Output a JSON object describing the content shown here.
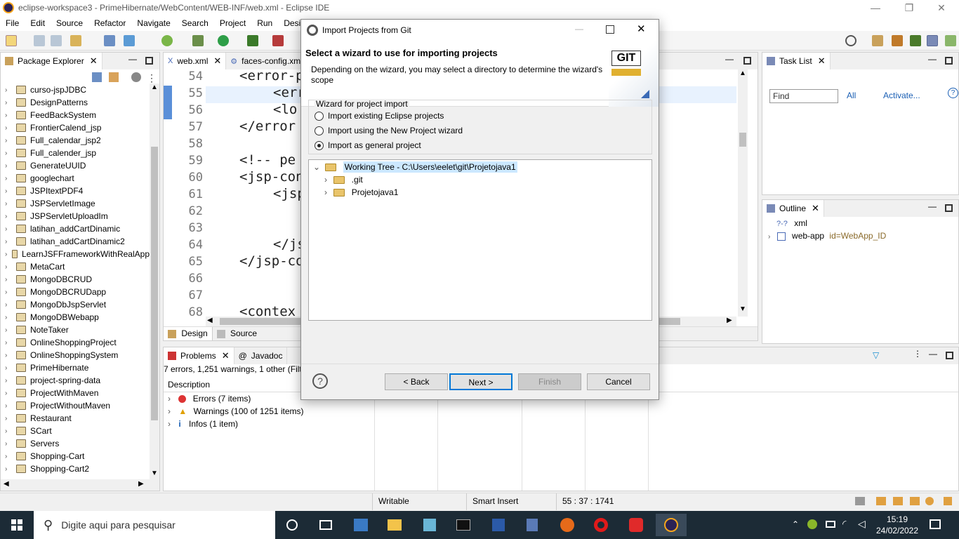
{
  "window": {
    "title": "eclipse-workspace3 - PrimeHibernate/WebContent/WEB-INF/web.xml - Eclipse IDE",
    "controls": [
      "—",
      "❐",
      "✕"
    ]
  },
  "menu": [
    "File",
    "Edit",
    "Source",
    "Refactor",
    "Navigate",
    "Search",
    "Project",
    "Run",
    "Design"
  ],
  "package_explorer": {
    "tab_label": "Package Explorer",
    "projects": [
      "curso-jspJDBC",
      "DesignPatterns",
      "FeedBackSystem",
      "FrontierCalend_jsp",
      "Full_calendar_jsp2",
      "Full_calender_jsp",
      "GenerateUUID",
      "googlechart",
      "JSPItextPDF4",
      "JSPServletImage",
      "JSPServletUploadIm",
      "latihan_addCartDinamic",
      "latihan_addCartDinamic2",
      "LearnJSFFrameworkWithRealApp",
      "MetaCart",
      "MongoDBCRUD",
      "MongoDBCRUDapp",
      "MongoDbJspServlet",
      "MongoDBWebapp",
      "NoteTaker",
      "OnlineShoppingProject",
      "OnlineShoppingSystem",
      "PrimeHibernate",
      "project-spring-data",
      "ProjectWithMaven",
      "ProjectWithoutMaven",
      "Restaurant",
      "SCart",
      "Servers",
      "Shopping-Cart",
      "Shopping-Cart2"
    ]
  },
  "editor": {
    "tabs": [
      "web.xml",
      "faces-config.xml"
    ],
    "lines": [
      {
        "no": "54",
        "code": "<error-p"
      },
      {
        "no": "55",
        "code": "<err"
      },
      {
        "no": "56",
        "code": "<lo"
      },
      {
        "no": "57",
        "code": "</error"
      },
      {
        "no": "58",
        "code": ""
      },
      {
        "no": "59",
        "code": "<!-- pe"
      },
      {
        "no": "60",
        "code": "<jsp-con"
      },
      {
        "no": "61",
        "code": "<jsp"
      },
      {
        "no": "62",
        "code": ""
      },
      {
        "no": "63",
        "code": ""
      },
      {
        "no": "64",
        "code": "</js"
      },
      {
        "no": "65",
        "code": "</jsp-co"
      },
      {
        "no": "66",
        "code": ""
      },
      {
        "no": "67",
        "code": ""
      },
      {
        "no": "68",
        "code": "<contex"
      }
    ],
    "bottom_tabs": [
      "Design",
      "Source"
    ]
  },
  "problems": {
    "tabs": [
      "Problems",
      "Javadoc"
    ],
    "summary": "7 errors, 1,251 warnings, 1 other (Filte",
    "column": "Description",
    "rows": [
      "Errors (7 items)",
      "Warnings (100 of 1251 items)",
      "Infos (1 item)"
    ]
  },
  "tasklist": {
    "tab_label": "Task List",
    "find_placeholder": "Find",
    "all_label": "All",
    "activate_label": "Activate..."
  },
  "outline": {
    "tab_label": "Outline",
    "items": [
      {
        "label": "xml",
        "attr": ""
      },
      {
        "label": "web-app",
        "attr": "id=WebApp_ID"
      }
    ]
  },
  "status": {
    "mode": "Writable",
    "insert": "Smart Insert",
    "position": "55 : 37 : 1741"
  },
  "dialog": {
    "title": "Import Projects from Git",
    "heading": "Select a wizard to use for importing projects",
    "description": "Depending on the wizard, you may select a directory to determine the wizard's scope",
    "logo_text": "GIT",
    "group_label": "Wizard for project import",
    "options": [
      {
        "label": "Import existing Eclipse projects",
        "selected": false
      },
      {
        "label": "Import using the New Project wizard",
        "selected": false
      },
      {
        "label": "Import as general project",
        "selected": true
      }
    ],
    "tree": [
      {
        "label": "Working Tree - C:\\Users\\eelet\\git\\Projetojava1",
        "level": 0,
        "expanded": true
      },
      {
        "label": ".git",
        "level": 1,
        "expanded": false
      },
      {
        "label": "Projetojava1",
        "level": 1,
        "expanded": false
      }
    ],
    "buttons": {
      "back": "< Back",
      "next": "Next >",
      "finish": "Finish",
      "cancel": "Cancel"
    }
  },
  "taskbar": {
    "search_placeholder": "Digite aqui para pesquisar",
    "time": "15:19",
    "date": "24/02/2022"
  }
}
